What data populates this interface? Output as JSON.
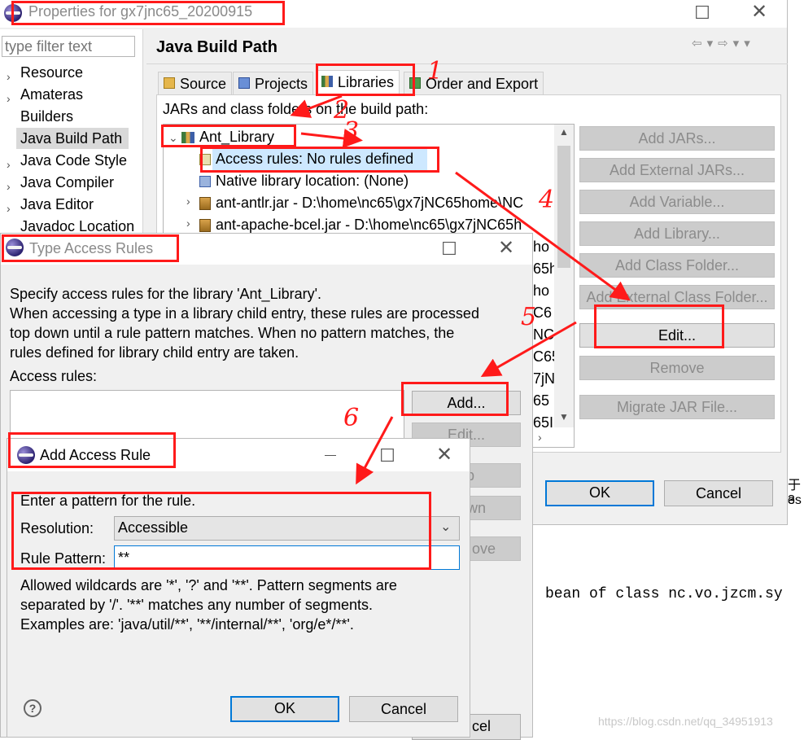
{
  "properties": {
    "title": "Properties for gx7jnc65_20200915",
    "filter_placeholder": "type filter text",
    "nav": [
      "Resource",
      "Amateras",
      "Builders",
      "Java Build Path",
      "Java Code Style",
      "Java Compiler",
      "Java Editor",
      "Javadoc Location"
    ],
    "page_title": "Java Build Path",
    "tabs": [
      "Source",
      "Projects",
      "Libraries",
      "Order and Export"
    ],
    "section_label": "JARs and class folders on the build path:",
    "tree": {
      "root": "Ant_Library",
      "child_access": "Access rules: No rules defined",
      "child_native": "Native library location: (None)",
      "jars": [
        "ant-antlr.jar - D:\\home\\nc65\\gx7jNC65home\\NC",
        "ant-apache-bcel.jar - D:\\home\\nc65\\gx7jNC65h"
      ],
      "cut_right": [
        "ho",
        "65h",
        "ho",
        "C6",
        "NC",
        "C65",
        "7jN",
        "65",
        "65I"
      ]
    },
    "buttons": [
      "Add JARs...",
      "Add External JARs...",
      "Add Variable...",
      "Add Library...",
      "Add Class Folder...",
      "Add External Class Folder...",
      "Edit...",
      "Remove",
      "Migrate JAR File..."
    ],
    "ok": "OK",
    "cancel": "Cancel"
  },
  "type_access": {
    "title": "Type Access Rules",
    "desc": [
      "Specify access rules for the library 'Ant_Library'.",
      "When accessing a type in a library child entry, these rules are processed",
      "top down until a rule pattern matches. When no pattern matches, the",
      "rules defined for library child entry are taken."
    ],
    "access_label": "Access rules:",
    "add_label": "Add...",
    "edit_label": "Edit...",
    "right_fragments": [
      "p",
      "wn",
      "ove"
    ],
    "cancel_fragment": "cel"
  },
  "add_rule": {
    "title": "Add Access Rule",
    "intro": "Enter a pattern for the rule.",
    "resolution_label": "Resolution:",
    "resolution_value": "Accessible",
    "pattern_label": "Rule Pattern:",
    "pattern_value": "**",
    "help": [
      "Allowed wildcards are '*', '?' and '**'. Pattern segments are",
      "separated by '/'. '**' matches any number of segments.",
      "Examples are: 'java/util/**', '**/internal/**', 'org/e*/**'."
    ],
    "ok": "OK",
    "cancel": "Cancel"
  },
  "background": {
    "code": "bean of class nc.vo.jzcm.sy",
    "side_chars": [
      "于3",
      "es"
    ],
    "watermark": "https://blog.csdn.net/qq_34951913"
  },
  "annotations": [
    "1",
    "2",
    "3",
    "4",
    "5",
    "6"
  ],
  "colors": {
    "annotation": "#ff1a1a",
    "focus": "#0078d7",
    "dialog_bg": "#f0f0f0"
  }
}
